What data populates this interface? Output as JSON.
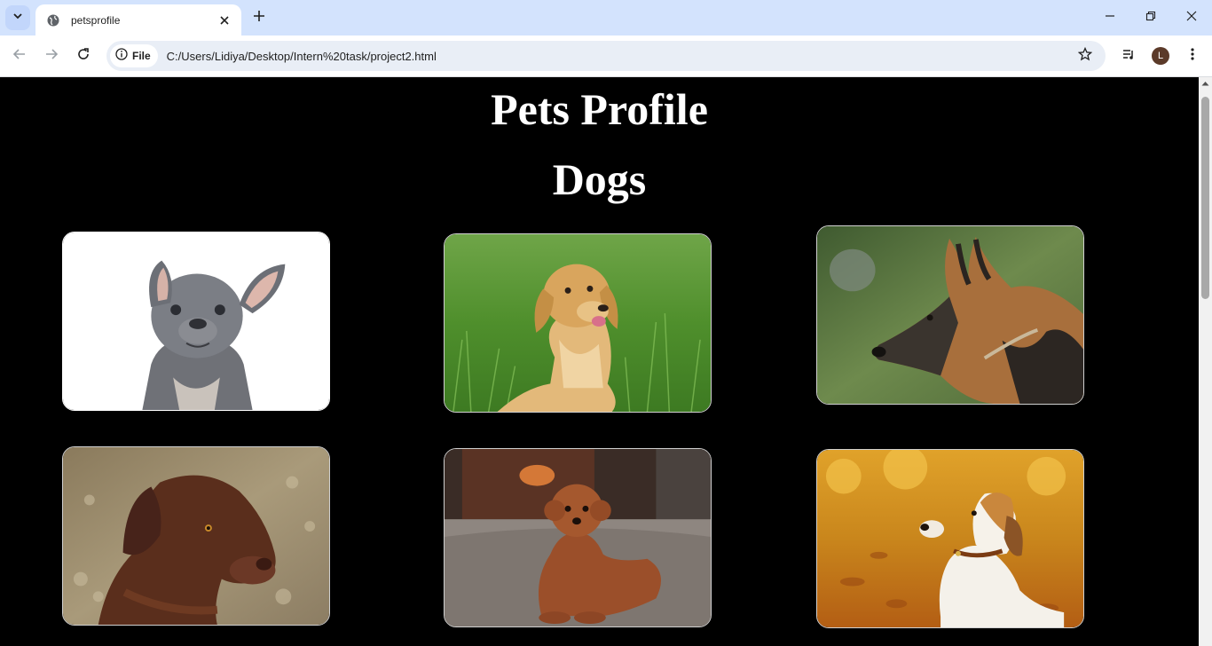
{
  "browser": {
    "tab_title": "petsprofile",
    "url": "C:/Users/Lidiya/Desktop/Intern%20task/project2.html",
    "site_chip_label": "File",
    "profile_initial": "L"
  },
  "page": {
    "title": "Pets Profile",
    "section_title": "Dogs"
  },
  "dogs": [
    {
      "photo": "french-bulldog"
    },
    {
      "photo": "golden-retriever"
    },
    {
      "photo": "german-shepherd"
    },
    {
      "photo": "chocolate-labrador"
    },
    {
      "photo": "toy-poodle"
    },
    {
      "photo": "beagle"
    }
  ],
  "colors": {
    "tabstrip": "#d3e3fd",
    "page_background": "#000000",
    "heading_text": "#ffffff"
  }
}
